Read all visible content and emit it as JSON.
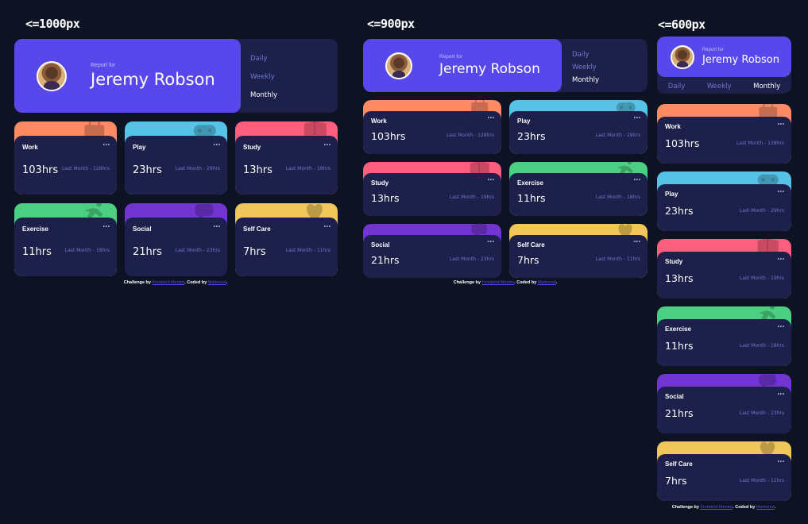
{
  "breakpoints": [
    {
      "label": "<=1000px"
    },
    {
      "label": "<=900px"
    },
    {
      "label": "<=600px"
    }
  ],
  "profile": {
    "report_for": "Report for",
    "name": "Jeremy Robson",
    "periods": [
      "Daily",
      "Weekly",
      "Monthly"
    ],
    "active_period": "Monthly"
  },
  "cards": [
    {
      "title": "Work",
      "hours": "103hrs",
      "previous": "Last Month - 128hrs",
      "color": "#ff8b64",
      "icon": "briefcase-icon"
    },
    {
      "title": "Play",
      "hours": "23hrs",
      "previous": "Last Month - 29hrs",
      "color": "#55c2e6",
      "icon": "gamepad-icon"
    },
    {
      "title": "Study",
      "hours": "13hrs",
      "previous": "Last Month - 19hrs",
      "color": "#ff5e7d",
      "icon": "book-icon"
    },
    {
      "title": "Exercise",
      "hours": "11hrs",
      "previous": "Last Month - 18hrs",
      "color": "#4bcf82",
      "icon": "runner-icon"
    },
    {
      "title": "Social",
      "hours": "21hrs",
      "previous": "Last Month - 23hrs",
      "color": "#7335d2",
      "icon": "chat-icon"
    },
    {
      "title": "Self Care",
      "hours": "7hrs",
      "previous": "Last Month - 11hrs",
      "color": "#f1c75b",
      "icon": "heart-icon"
    }
  ],
  "menu_dots": "•••",
  "attribution": {
    "prefix": "Challenge by ",
    "link1": "Frontend Mentor",
    "middle": ". Coded by ",
    "link2": "Markonet",
    "suffix": "."
  }
}
